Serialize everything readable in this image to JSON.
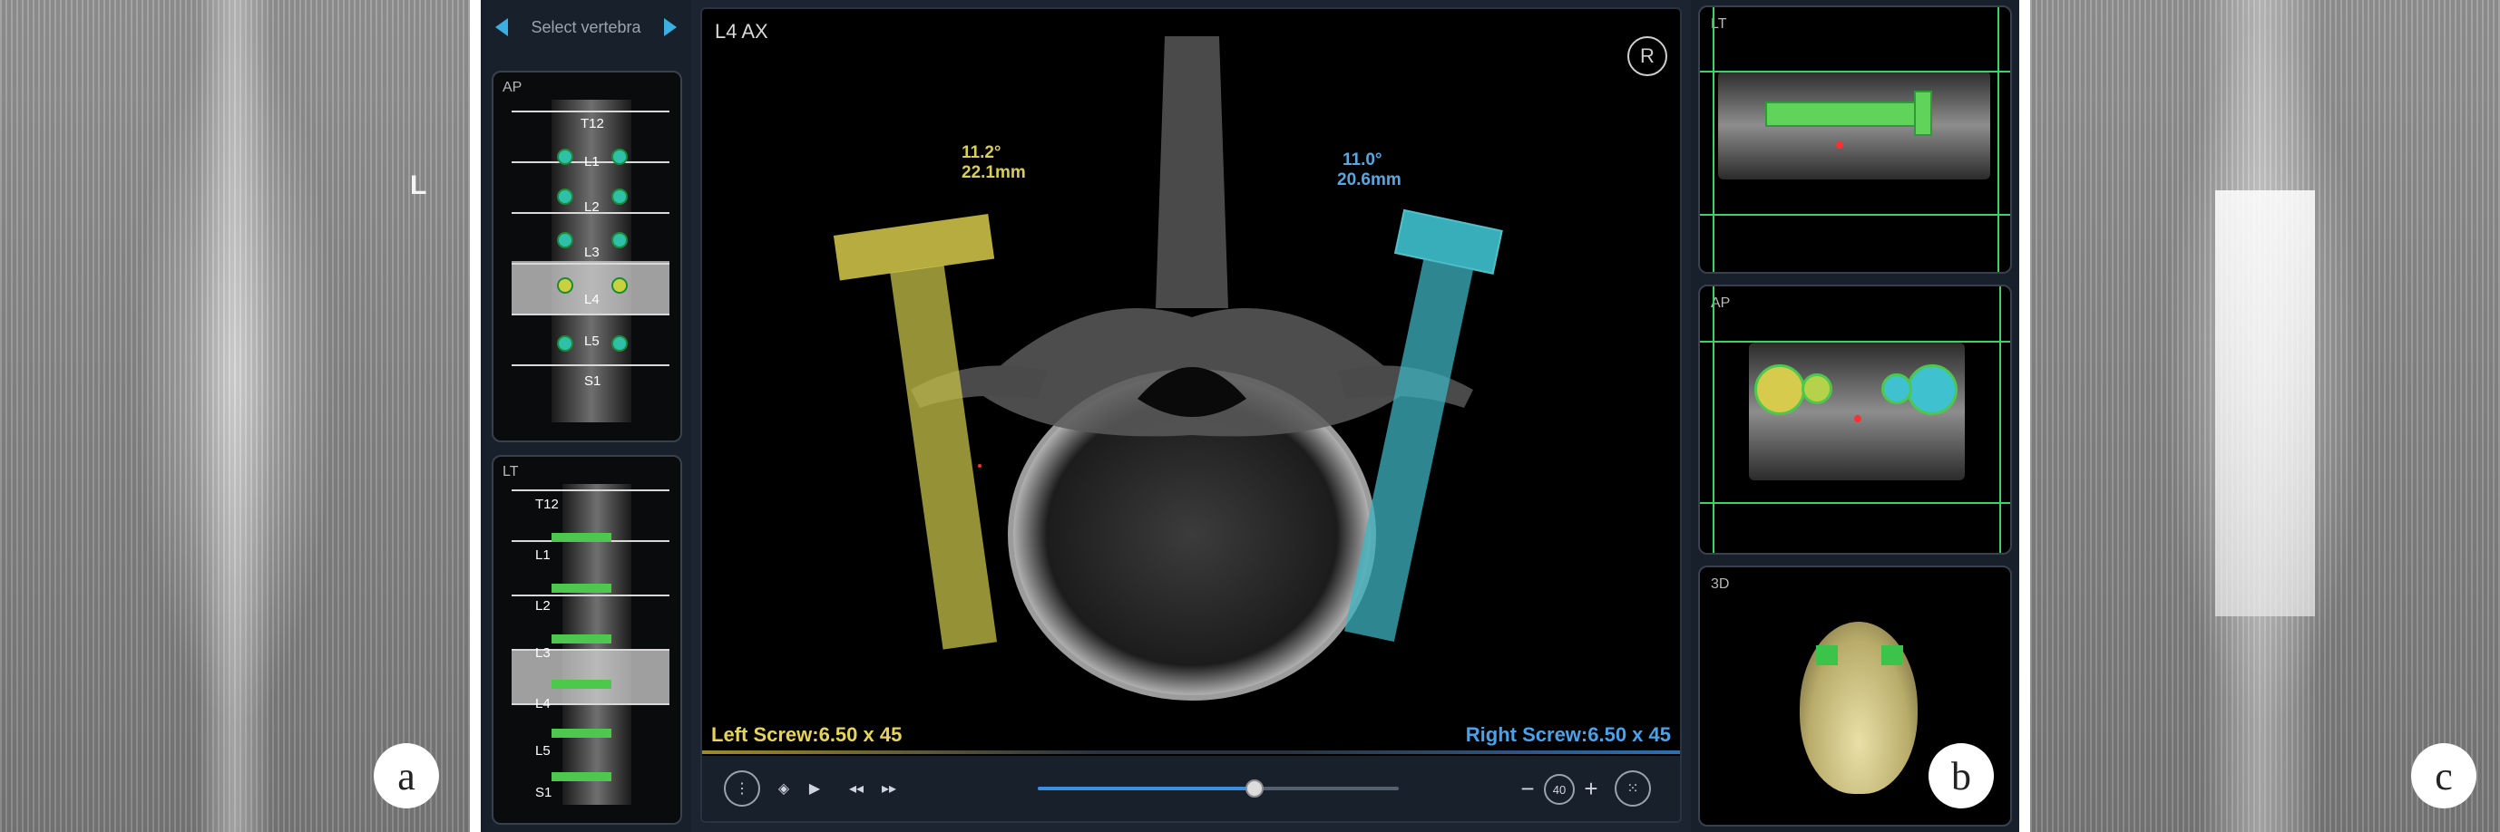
{
  "panel_tags": {
    "a": "a",
    "b": "b",
    "c": "c"
  },
  "xray_side_marker": "L",
  "nav_ui": {
    "vertebra_selector": {
      "label": "Select vertebra"
    },
    "thumbnails": {
      "ap": {
        "view_label": "AP",
        "levels": [
          "T12",
          "L1",
          "L2",
          "L3",
          "L4",
          "L5",
          "S1"
        ]
      },
      "lt": {
        "view_label": "LT",
        "levels": [
          "T12",
          "L1",
          "L2",
          "L3",
          "L4",
          "L5",
          "S1"
        ]
      }
    },
    "main_view": {
      "label": "L4  AX",
      "r_icon": "R",
      "left_annotation": {
        "angle": "11.2°",
        "depth": "22.1mm"
      },
      "right_annotation": {
        "angle": "11.0°",
        "depth": "20.6mm"
      },
      "left_screw": "Left Screw:6.50 x 45",
      "right_screw": "Right Screw:6.50 x 45"
    },
    "toolbar": {
      "slider_fraction": 0.6,
      "zoom_value": "40",
      "icons": [
        "more-vertical-icon",
        "layers-icon",
        "play-icon",
        "rewind-icon",
        "fast-forward-icon",
        "zoom-out-icon",
        "zoom-in-icon",
        "fit-view-icon"
      ]
    },
    "side_views": {
      "lt": {
        "view_label": "LT"
      },
      "ap": {
        "view_label": "AP"
      },
      "three_d": {
        "view_label": "3D"
      }
    },
    "colors": {
      "left_screw": "#d6cb4c",
      "right_screw": "#3fc1cf",
      "accent_blue": "#3d8ee0",
      "guide_green": "#3cd26a"
    }
  }
}
